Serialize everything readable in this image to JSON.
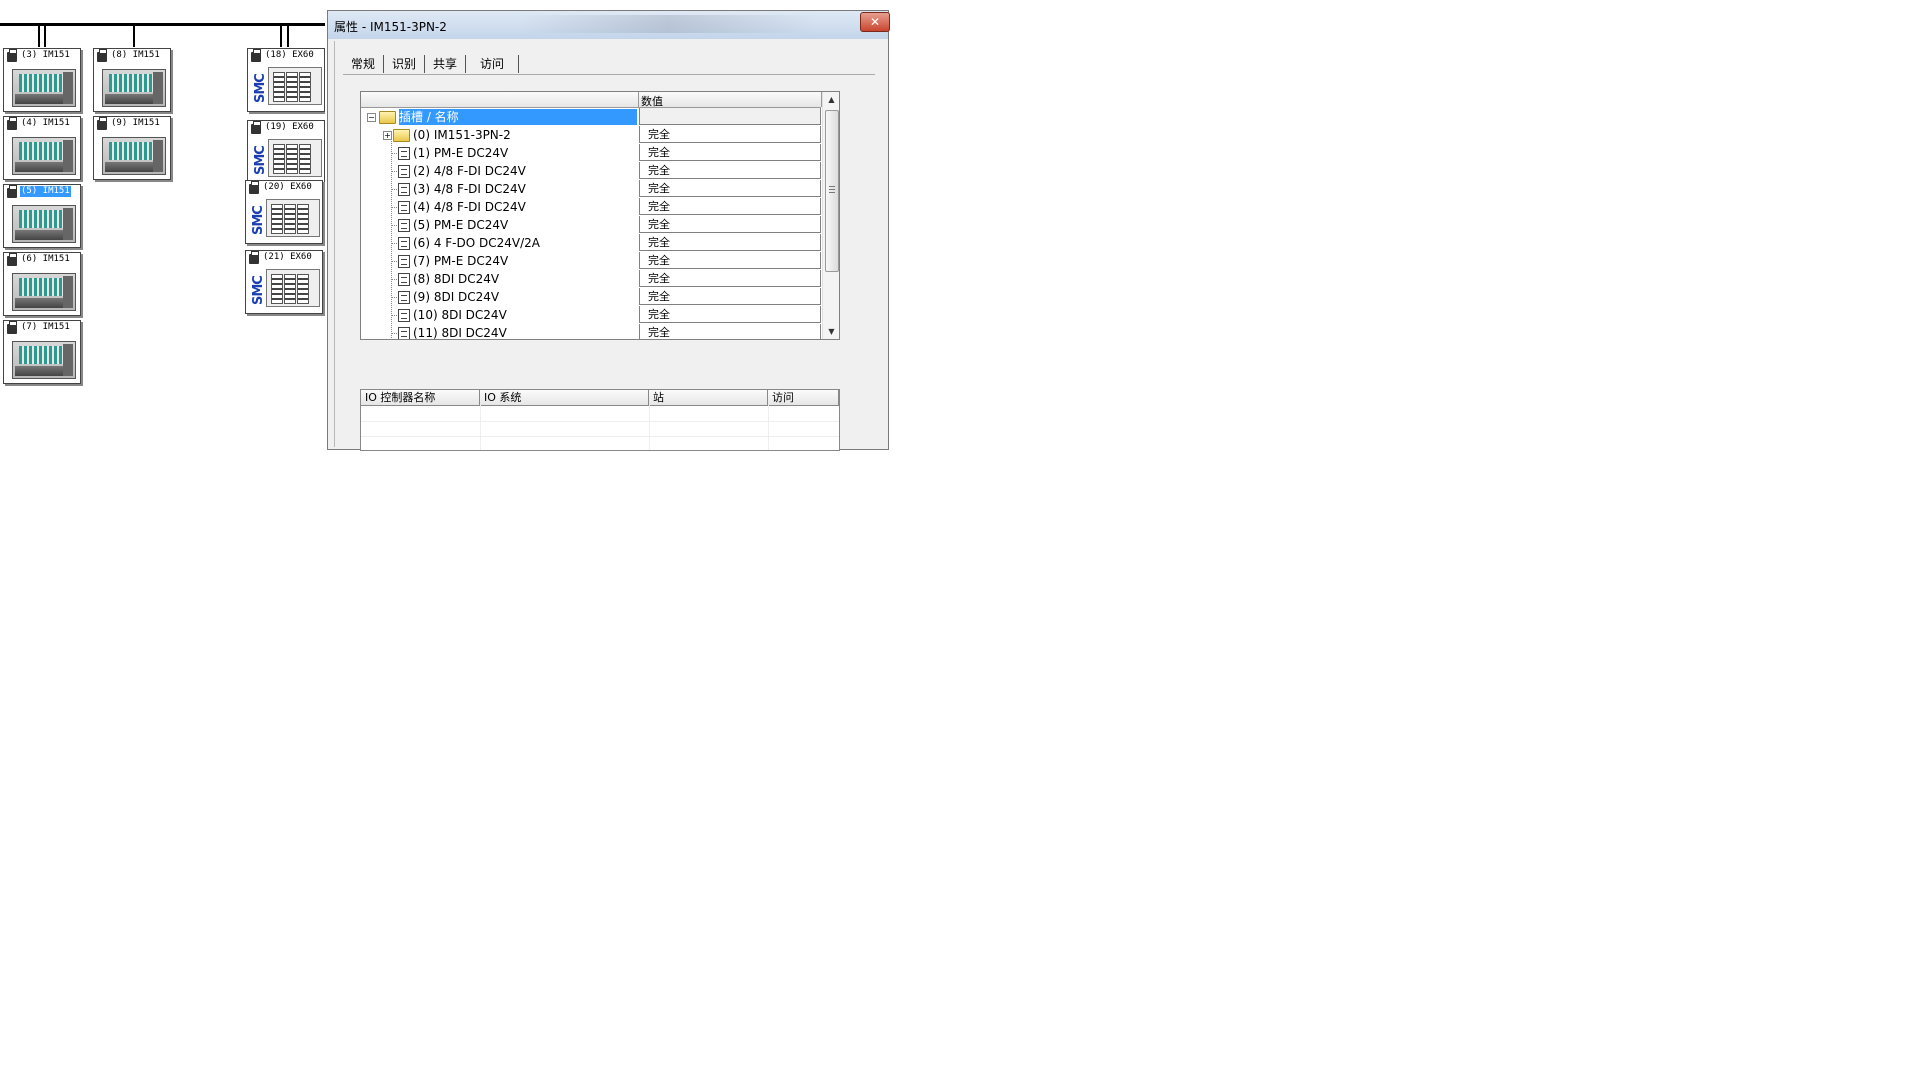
{
  "network": {
    "nodes": [
      {
        "label": "(3) IM151",
        "selected": false
      },
      {
        "label": "(8) IM151",
        "selected": false
      },
      {
        "label": "(4) IM151",
        "selected": false
      },
      {
        "label": "(9) IM151",
        "selected": false
      },
      {
        "label": "(5) IM151",
        "selected": true
      },
      {
        "label": "(6) IM151",
        "selected": false
      },
      {
        "label": "(7) IM151",
        "selected": false
      }
    ],
    "ex_nodes": [
      {
        "label": "(18) EX60",
        "brand": "SMC"
      },
      {
        "label": "(19) EX60",
        "brand": "SMC"
      },
      {
        "label": "(20) EX60",
        "brand": "SMC"
      },
      {
        "label": "(21) EX60",
        "brand": "SMC"
      }
    ]
  },
  "dialog": {
    "title": "属性 - IM151-3PN-2",
    "close_glyph": "✕",
    "tabs": [
      {
        "label": "常规",
        "active": false
      },
      {
        "label": "识别",
        "active": false
      },
      {
        "label": "共享",
        "active": false
      },
      {
        "label": "访问",
        "active": true
      }
    ],
    "tree": {
      "header_name": "",
      "header_value": "数值",
      "root_label": "插槽 / 名称",
      "rows": [
        {
          "label": "(0) IM151-3PN-2",
          "value": "完全",
          "kind": "folder"
        },
        {
          "label": "(1) PM-E DC24V",
          "value": "完全",
          "kind": "module"
        },
        {
          "label": "(2) 4/8 F-DI DC24V",
          "value": "完全",
          "kind": "module"
        },
        {
          "label": "(3) 4/8 F-DI DC24V",
          "value": "完全",
          "kind": "module"
        },
        {
          "label": "(4) 4/8 F-DI DC24V",
          "value": "完全",
          "kind": "module"
        },
        {
          "label": "(5) PM-E DC24V",
          "value": "完全",
          "kind": "module"
        },
        {
          "label": "(6) 4 F-DO DC24V/2A",
          "value": "完全",
          "kind": "module"
        },
        {
          "label": "(7) PM-E DC24V",
          "value": "完全",
          "kind": "module"
        },
        {
          "label": "(8) 8DI DC24V",
          "value": "完全",
          "kind": "module"
        },
        {
          "label": "(9) 8DI DC24V",
          "value": "完全",
          "kind": "module"
        },
        {
          "label": "(10) 8DI DC24V",
          "value": "完全",
          "kind": "module"
        },
        {
          "label": "(11) 8DI DC24V",
          "value": "完全",
          "kind": "module"
        }
      ]
    },
    "access_table": {
      "columns": [
        "IO 控制器名称",
        "IO 系统",
        "站",
        "访问"
      ]
    }
  },
  "colors": {
    "selection": "#3399ff",
    "title_bar": "#c4d5ea"
  }
}
